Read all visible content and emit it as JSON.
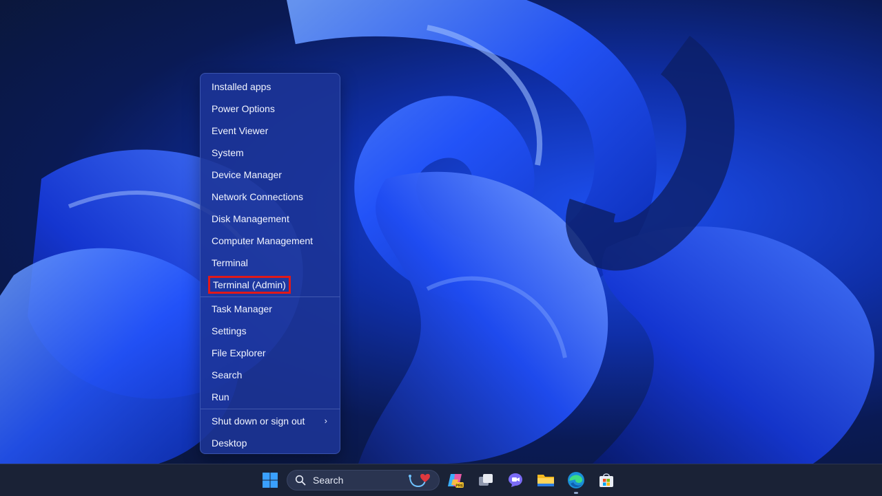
{
  "menu": {
    "items": [
      {
        "label": "Installed apps"
      },
      {
        "label": "Power Options"
      },
      {
        "label": "Event Viewer"
      },
      {
        "label": "System"
      },
      {
        "label": "Device Manager"
      },
      {
        "label": "Network Connections"
      },
      {
        "label": "Disk Management"
      },
      {
        "label": "Computer Management"
      },
      {
        "label": "Terminal"
      },
      {
        "label": "Terminal (Admin)"
      }
    ],
    "items2": [
      {
        "label": "Task Manager"
      },
      {
        "label": "Settings"
      },
      {
        "label": "File Explorer"
      },
      {
        "label": "Search"
      },
      {
        "label": "Run"
      }
    ],
    "items3": [
      {
        "label": "Shut down or sign out"
      },
      {
        "label": "Desktop"
      }
    ],
    "highlight_color": "#e01919"
  },
  "taskbar": {
    "search_placeholder": "Search",
    "icons": [
      "windows-start-icon",
      "search-icon",
      "copilot-icon",
      "task-view-icon",
      "teams-chat-icon",
      "file-explorer-icon",
      "edge-icon",
      "store-icon"
    ]
  }
}
